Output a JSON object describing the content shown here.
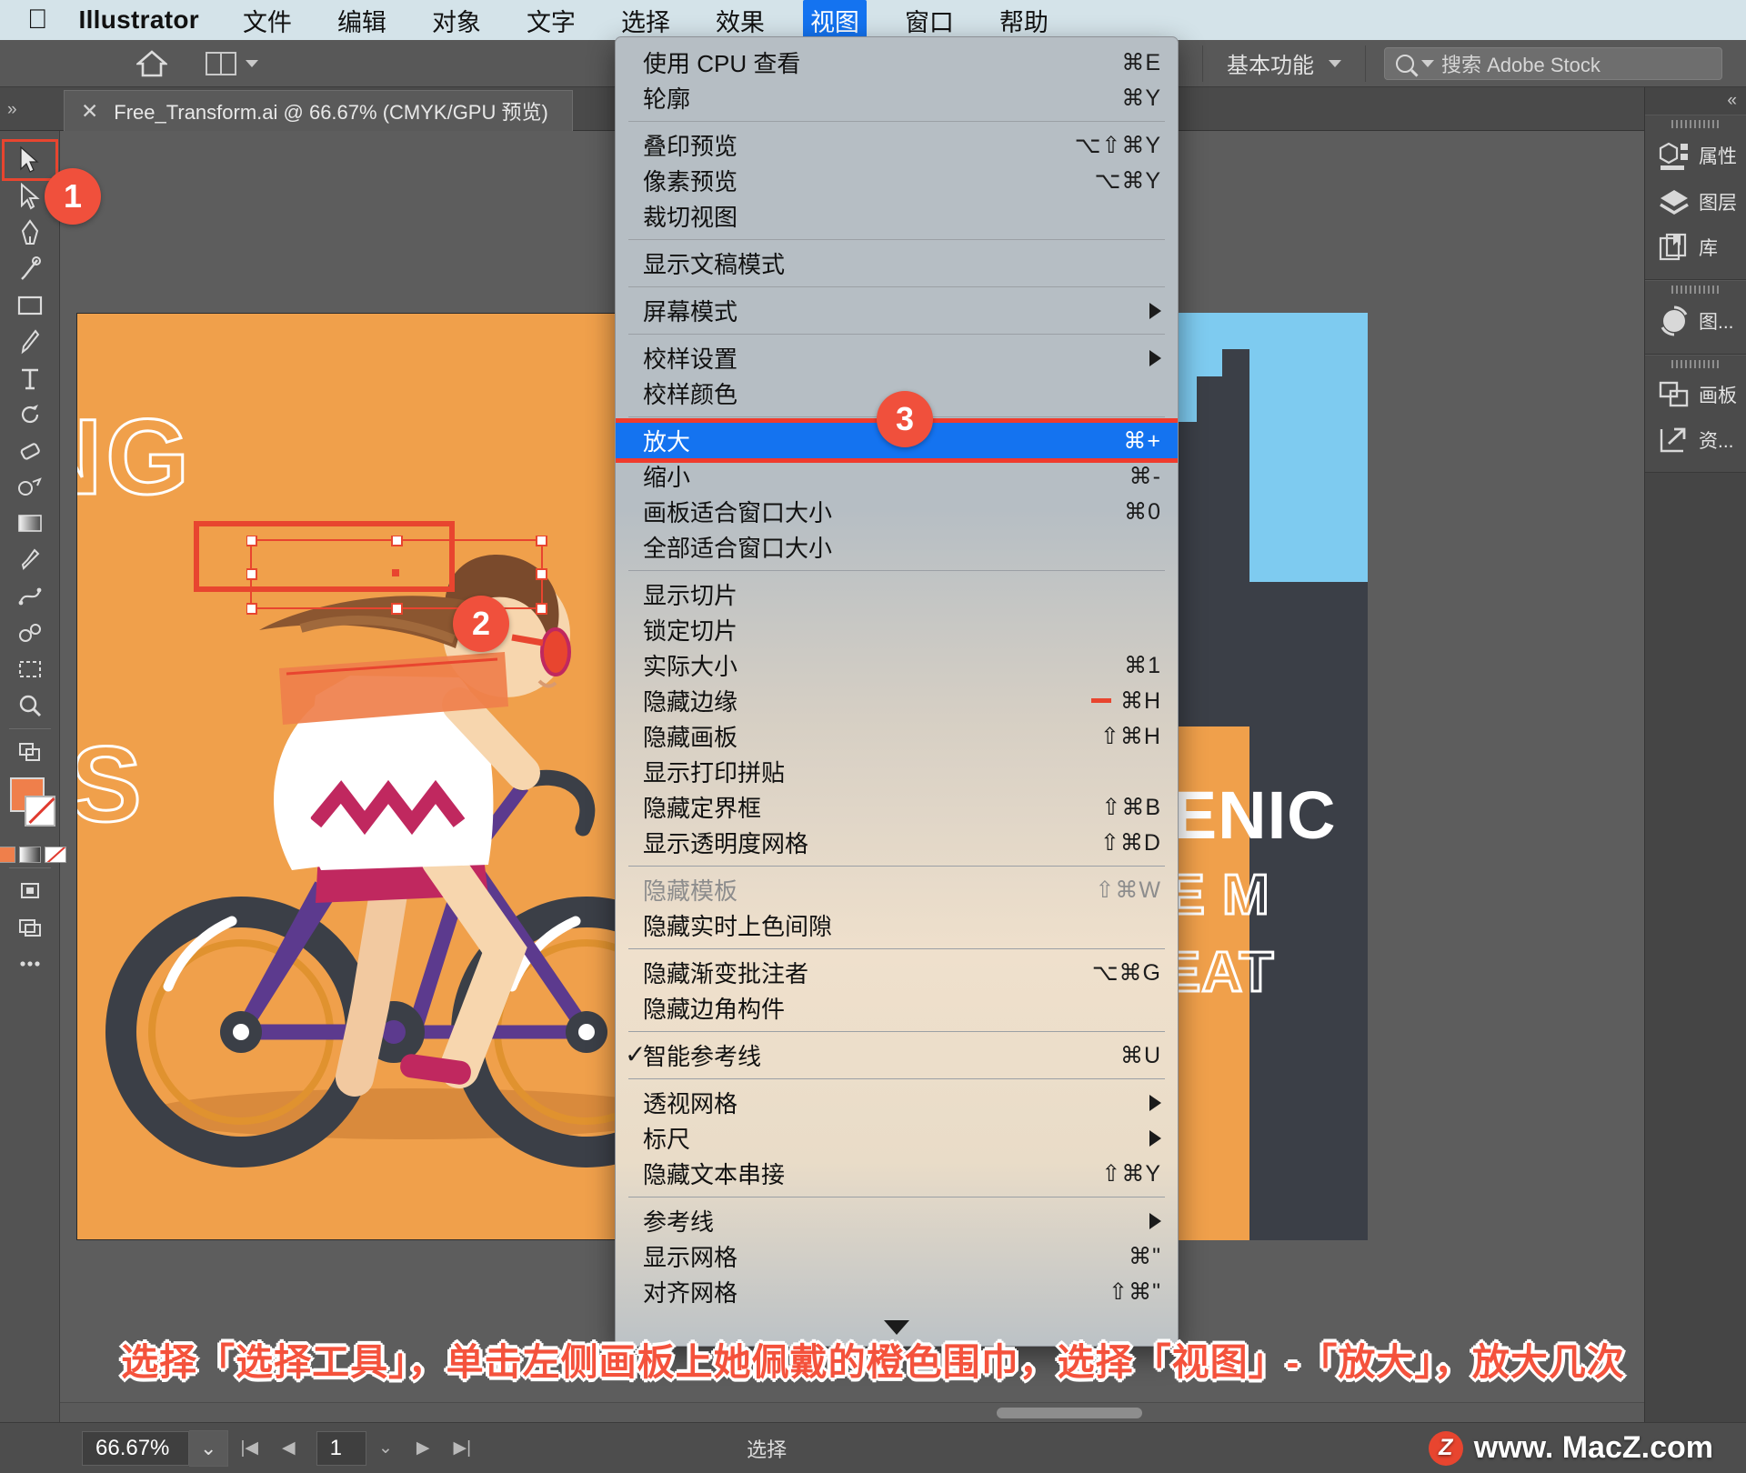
{
  "macbar": {
    "apple_icon": "apple-logo",
    "app_name": "Illustrator",
    "menus": [
      {
        "label": "文件",
        "active": false
      },
      {
        "label": "编辑",
        "active": false
      },
      {
        "label": "对象",
        "active": false
      },
      {
        "label": "文字",
        "active": false
      },
      {
        "label": "选择",
        "active": false
      },
      {
        "label": "效果",
        "active": false
      },
      {
        "label": "视图",
        "active": true
      },
      {
        "label": "窗口",
        "active": false
      },
      {
        "label": "帮助",
        "active": false
      }
    ]
  },
  "appbar": {
    "workspace": "基本功能",
    "search_placeholder": "搜索 Adobe Stock"
  },
  "tab": {
    "close_glyph": "✕",
    "title": "Free_Transform.ai @ 66.67% (CMYK/GPU 预览)"
  },
  "view_menu": {
    "groups": [
      {
        "items": [
          {
            "label": "使用 CPU 查看",
            "key": "⌘E"
          },
          {
            "label": "轮廓",
            "key": "⌘Y"
          }
        ]
      },
      {
        "items": [
          {
            "label": "叠印预览",
            "key": "⌥⇧⌘Y"
          },
          {
            "label": "像素预览",
            "key": "⌥⌘Y"
          },
          {
            "label": "裁切视图",
            "key": ""
          }
        ]
      },
      {
        "items": [
          {
            "label": "显示文稿模式",
            "key": ""
          }
        ]
      },
      {
        "items": [
          {
            "label": "屏幕模式",
            "key": "",
            "submenu": true
          }
        ]
      },
      {
        "items": [
          {
            "label": "校样设置",
            "key": "",
            "submenu": true
          },
          {
            "label": "校样颜色",
            "key": ""
          }
        ]
      },
      {
        "items": [
          {
            "label": "放大",
            "key": "⌘+",
            "highlighted": true
          },
          {
            "label": "缩小",
            "key": "⌘-"
          },
          {
            "label": "画板适合窗口大小",
            "key": "⌘0"
          },
          {
            "label": "全部适合窗口大小",
            "key": ""
          }
        ]
      },
      {
        "items": [
          {
            "label": "显示切片",
            "key": ""
          },
          {
            "label": "锁定切片",
            "key": ""
          },
          {
            "label": "实际大小",
            "key": "⌘1"
          },
          {
            "label": "隐藏边缘",
            "key": "⌘H",
            "marker": true
          },
          {
            "label": "隐藏画板",
            "key": "⇧⌘H"
          },
          {
            "label": "显示打印拼贴",
            "key": ""
          },
          {
            "label": "隐藏定界框",
            "key": "⇧⌘B"
          },
          {
            "label": "显示透明度网格",
            "key": "⇧⌘D"
          }
        ]
      },
      {
        "items": [
          {
            "label": "隐藏模板",
            "key": "⇧⌘W",
            "disabled": true
          },
          {
            "label": "隐藏实时上色间隙",
            "key": ""
          }
        ]
      },
      {
        "items": [
          {
            "label": "隐藏渐变批注者",
            "key": "⌥⌘G"
          },
          {
            "label": "隐藏边角构件",
            "key": ""
          }
        ]
      },
      {
        "items": [
          {
            "label": "智能参考线",
            "key": "⌘U",
            "checked": true
          }
        ]
      },
      {
        "items": [
          {
            "label": "透视网格",
            "key": "",
            "submenu": true
          },
          {
            "label": "标尺",
            "key": "",
            "submenu": true
          },
          {
            "label": "隐藏文本串接",
            "key": "⇧⌘Y"
          }
        ]
      },
      {
        "items": [
          {
            "label": "参考线",
            "key": "",
            "submenu": true
          },
          {
            "label": "显示网格",
            "key": "⌘\""
          },
          {
            "label": "对齐网格",
            "key": "⇧⌘\""
          }
        ]
      }
    ],
    "scroll_down_glyph": "▼"
  },
  "dock": {
    "collapse_glyph": "«",
    "groups": [
      {
        "items": [
          {
            "label": "属性",
            "icon": "properties-icon"
          },
          {
            "label": "图层",
            "icon": "layers-icon"
          },
          {
            "label": "库",
            "icon": "library-icon"
          }
        ]
      },
      {
        "items": [
          {
            "label": "图...",
            "icon": "image-trace-icon"
          }
        ]
      },
      {
        "items": [
          {
            "label": "画板",
            "icon": "artboards-icon"
          },
          {
            "label": "资...",
            "icon": "asset-export-icon"
          }
        ]
      }
    ]
  },
  "tools": [
    {
      "name": "selection-tool",
      "selected": true
    },
    {
      "name": "direct-selection-tool",
      "selected": false
    },
    {
      "name": "pen-tool",
      "selected": false
    },
    {
      "name": "curvature-tool",
      "selected": false
    },
    {
      "name": "rectangle-tool",
      "selected": false
    },
    {
      "name": "paintbrush-tool",
      "selected": false
    },
    {
      "name": "type-tool",
      "selected": false
    },
    {
      "name": "rotate-tool",
      "selected": false
    },
    {
      "name": "eraser-tool",
      "selected": false
    },
    {
      "name": "shape-builder-tool",
      "selected": false
    },
    {
      "name": "gradient-tool",
      "selected": false
    },
    {
      "name": "eyedropper-tool",
      "selected": false
    },
    {
      "name": "blend-tool",
      "selected": false
    },
    {
      "name": "symbol-sprayer-tool",
      "selected": false
    },
    {
      "name": "artboard-tool",
      "selected": false
    },
    {
      "name": "zoom-tool",
      "selected": false
    }
  ],
  "status": {
    "zoom": "66.67%",
    "zoom_caret": "⌄",
    "first_glyph": "|◀",
    "prev_glyph": "◀",
    "page": "1",
    "page_caret": "⌄",
    "next_glyph": "▶",
    "last_glyph": "▶|",
    "label": "选择"
  },
  "artwork": {
    "left_text_1": "NG",
    "left_text_2": "S",
    "right_text_1": "SCENIC",
    "right_text_2": "LIVE M",
    "right_text_3": "GREAT"
  },
  "annotations": {
    "badge_1": "1",
    "badge_2": "2",
    "badge_3": "3",
    "caption": "选择「选择工具」，单击左侧画板上她佩戴的橙色围巾，选择「视图」-「放大」，放大几次"
  },
  "watermark": {
    "mark": "Z",
    "text": "www. MacZ.com"
  },
  "colors": {
    "accent_red": "#ef3b2d",
    "menu_highlight": "#1473f0",
    "artboard_orange": "#f0a04b",
    "sky_blue": "#7ecbf0"
  }
}
